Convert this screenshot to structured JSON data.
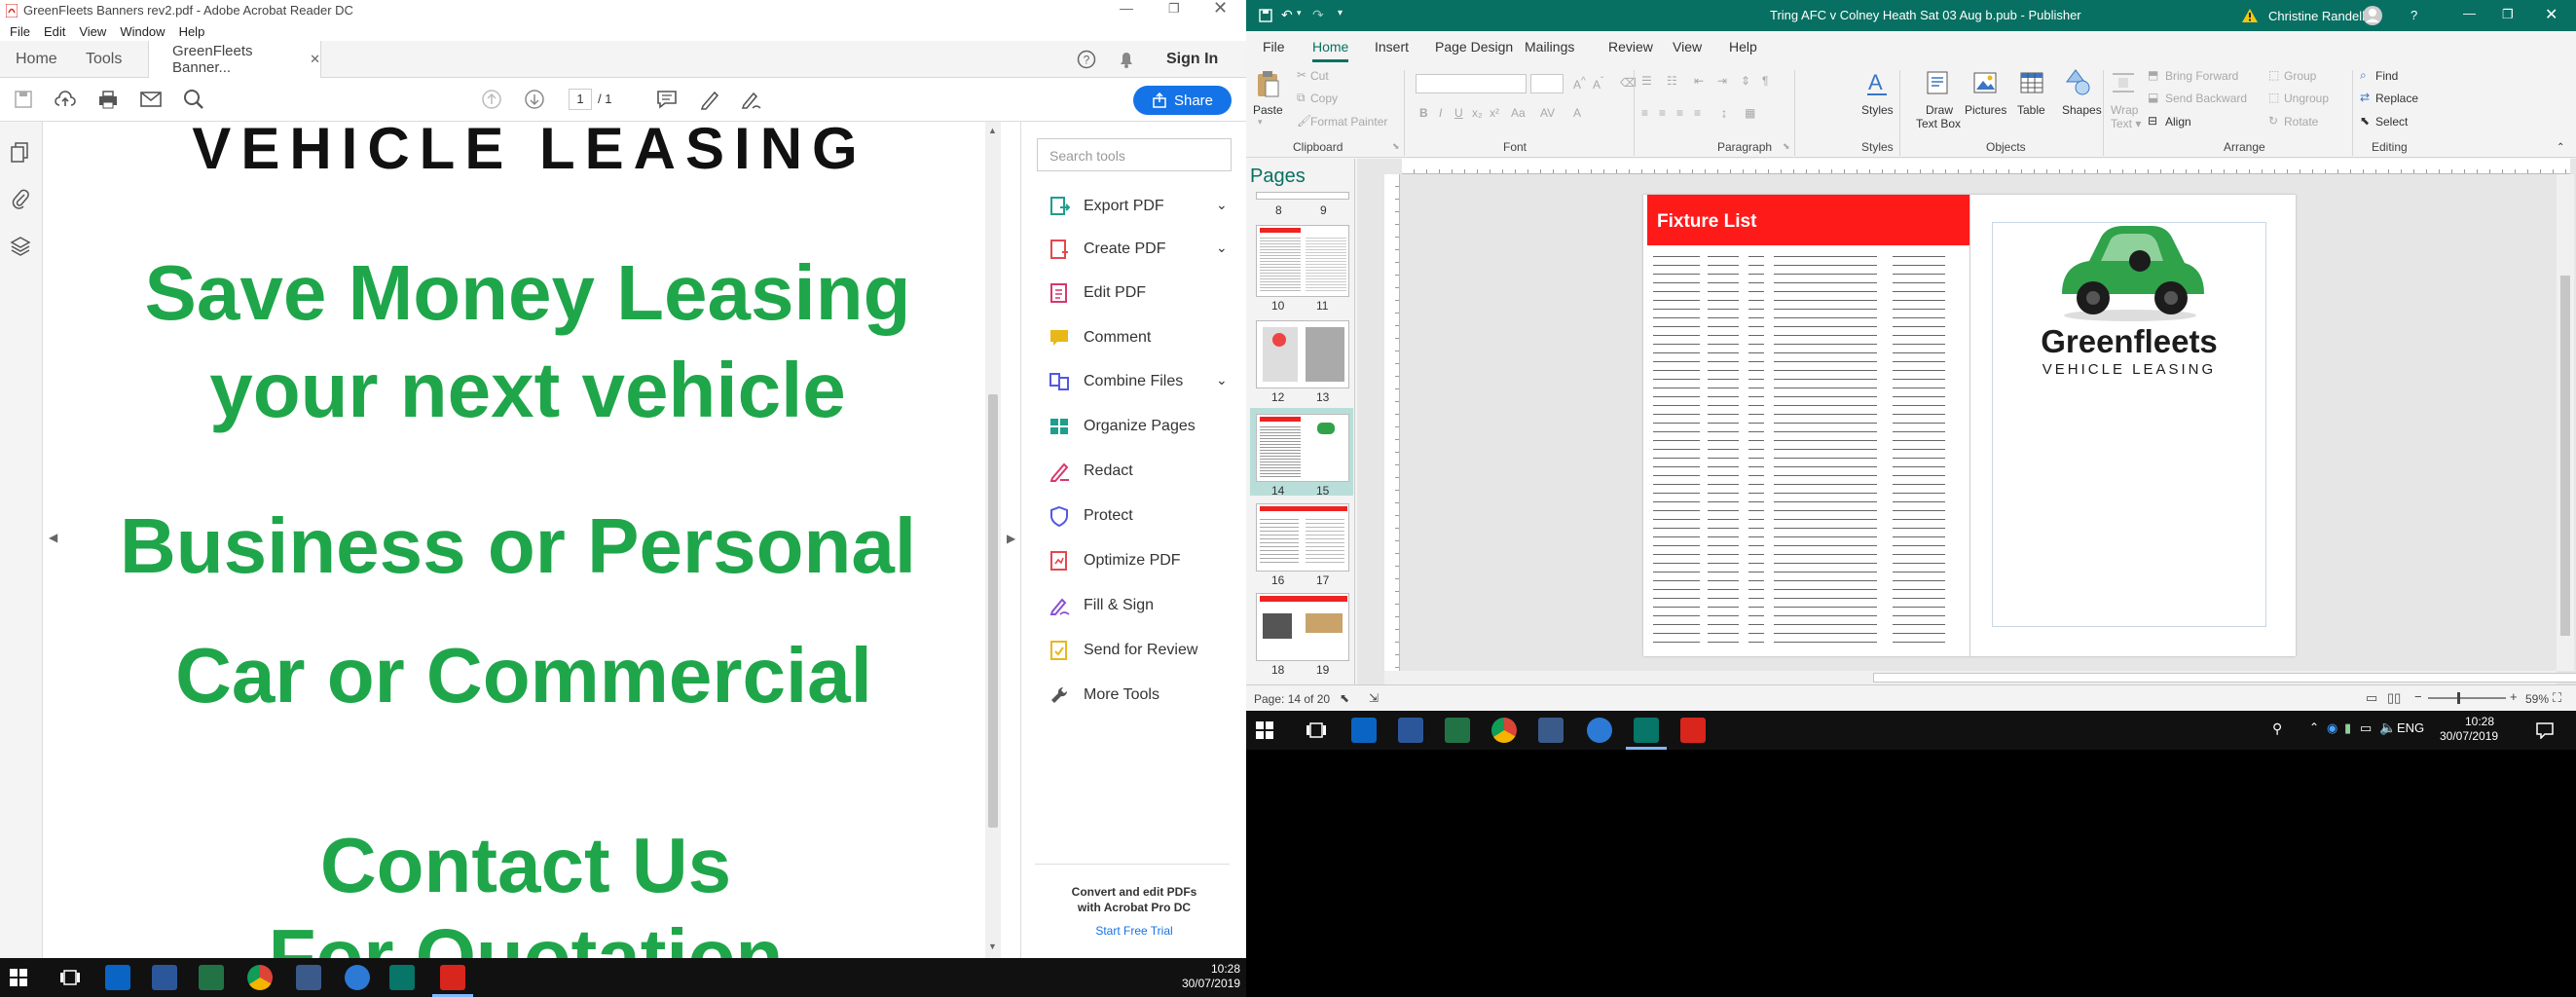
{
  "acrobat": {
    "title": "GreenFleets Banners rev2.pdf - Adobe Acrobat Reader DC",
    "menu": [
      "File",
      "Edit",
      "View",
      "Window",
      "Help"
    ],
    "tabs": {
      "home": "Home",
      "tools": "Tools",
      "doc": "GreenFleets Banner...",
      "sign_in": "Sign In"
    },
    "page_current": "1",
    "page_total": "/ 1",
    "share": "Share",
    "pdf_lines": [
      "VEHICLE LEASING",
      "Save Money Leasing",
      "your next vehicle",
      "Business or Personal",
      "Car or Commercial",
      "Contact Us",
      "For Quotation"
    ],
    "search_placeholder": "Search tools",
    "tools": [
      "Export PDF",
      "Create PDF",
      "Edit PDF",
      "Comment",
      "Combine Files",
      "Organize Pages",
      "Redact",
      "Protect",
      "Optimize PDF",
      "Fill & Sign",
      "Send for Review",
      "More Tools"
    ],
    "promo_line1": "Convert and edit PDFs",
    "promo_line2": "with Acrobat Pro DC",
    "promo_link": "Start Free Trial",
    "colors": {
      "pdf_green": "#1fa64a",
      "share_blue": "#1473e6"
    }
  },
  "publisher": {
    "title": "Tring AFC v Colney Heath Sat 03 Aug b.pub  -  Publisher",
    "user": "Christine Randell",
    "tabs": [
      "File",
      "Home",
      "Insert",
      "Page Design",
      "Mailings",
      "Review",
      "View",
      "Help"
    ],
    "ribbon": {
      "paste": "Paste",
      "cut": "Cut",
      "copy": "Copy",
      "format_painter": "Format Painter",
      "clipboard": "Clipboard",
      "font": "Font",
      "paragraph": "Paragraph",
      "styles": "Styles",
      "draw_text_box": "Draw Text Box",
      "pictures": "Pictures",
      "table": "Table",
      "shapes": "Shapes",
      "objects": "Objects",
      "wrap_text": "Wrap Text",
      "bring_forward": "Bring Forward",
      "send_backward": "Send Backward",
      "align": "Align",
      "group": "Group",
      "ungroup": "Ungroup",
      "rotate": "Rotate",
      "arrange": "Arrange",
      "find": "Find",
      "replace": "Replace",
      "select": "Select",
      "editing": "Editing"
    },
    "pages_label": "Pages",
    "thumb_pairs": [
      [
        "8",
        "9"
      ],
      [
        "10",
        "11"
      ],
      [
        "12",
        "13"
      ],
      [
        "14",
        "15"
      ],
      [
        "16",
        "17"
      ],
      [
        "18",
        "19"
      ]
    ],
    "doc": {
      "fixture_title": "Fixture List",
      "brand": "Greenfleets",
      "tagline": "VEHICLE LEASING"
    },
    "status": {
      "page": "Page: 14 of 20",
      "zoom": "59%"
    },
    "colors": {
      "title_bar": "#087062",
      "fixture_red": "#ff1a1a"
    }
  },
  "taskbar": {
    "time": "10:28",
    "date": "30/07/2019",
    "lang": "ENG"
  }
}
